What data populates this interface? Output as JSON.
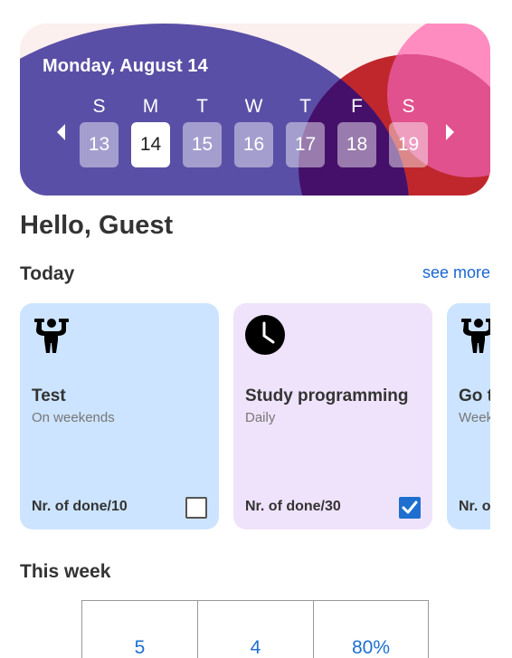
{
  "calendar": {
    "date_title": "Monday, August 14",
    "days": [
      {
        "dow": "S",
        "date": "13",
        "selected": false
      },
      {
        "dow": "M",
        "date": "14",
        "selected": true
      },
      {
        "dow": "T",
        "date": "15",
        "selected": false
      },
      {
        "dow": "W",
        "date": "16",
        "selected": false
      },
      {
        "dow": "T",
        "date": "17",
        "selected": false
      },
      {
        "dow": "F",
        "date": "18",
        "selected": false
      },
      {
        "dow": "S",
        "date": "19",
        "selected": false
      }
    ]
  },
  "greeting": "Hello, Guest",
  "today": {
    "title": "Today",
    "see_more": "see more",
    "cards": [
      {
        "icon": "strongman-icon",
        "title": "Test",
        "frequency": "On weekends",
        "done_label": "Nr. of done/10",
        "checked": false,
        "bg": "#cce4ff"
      },
      {
        "icon": "clock-icon",
        "title": "Study programming",
        "frequency": "Daily",
        "done_label": "Nr. of done/30",
        "checked": true,
        "bg": "#efe3fb"
      },
      {
        "icon": "strongman-icon",
        "title": "Go t",
        "frequency": "Week",
        "done_label": "Nr. o",
        "checked": false,
        "bg": "#cce4ff"
      }
    ]
  },
  "this_week": {
    "title": "This week",
    "stats": [
      "5",
      "4",
      "80%"
    ]
  },
  "colors": {
    "accent": "#1e6fd0",
    "hero_purple": "#5a4fa6",
    "hero_red": "#c0272d",
    "hero_pink": "#ff8cc0",
    "hero_dark": "#45106a"
  }
}
